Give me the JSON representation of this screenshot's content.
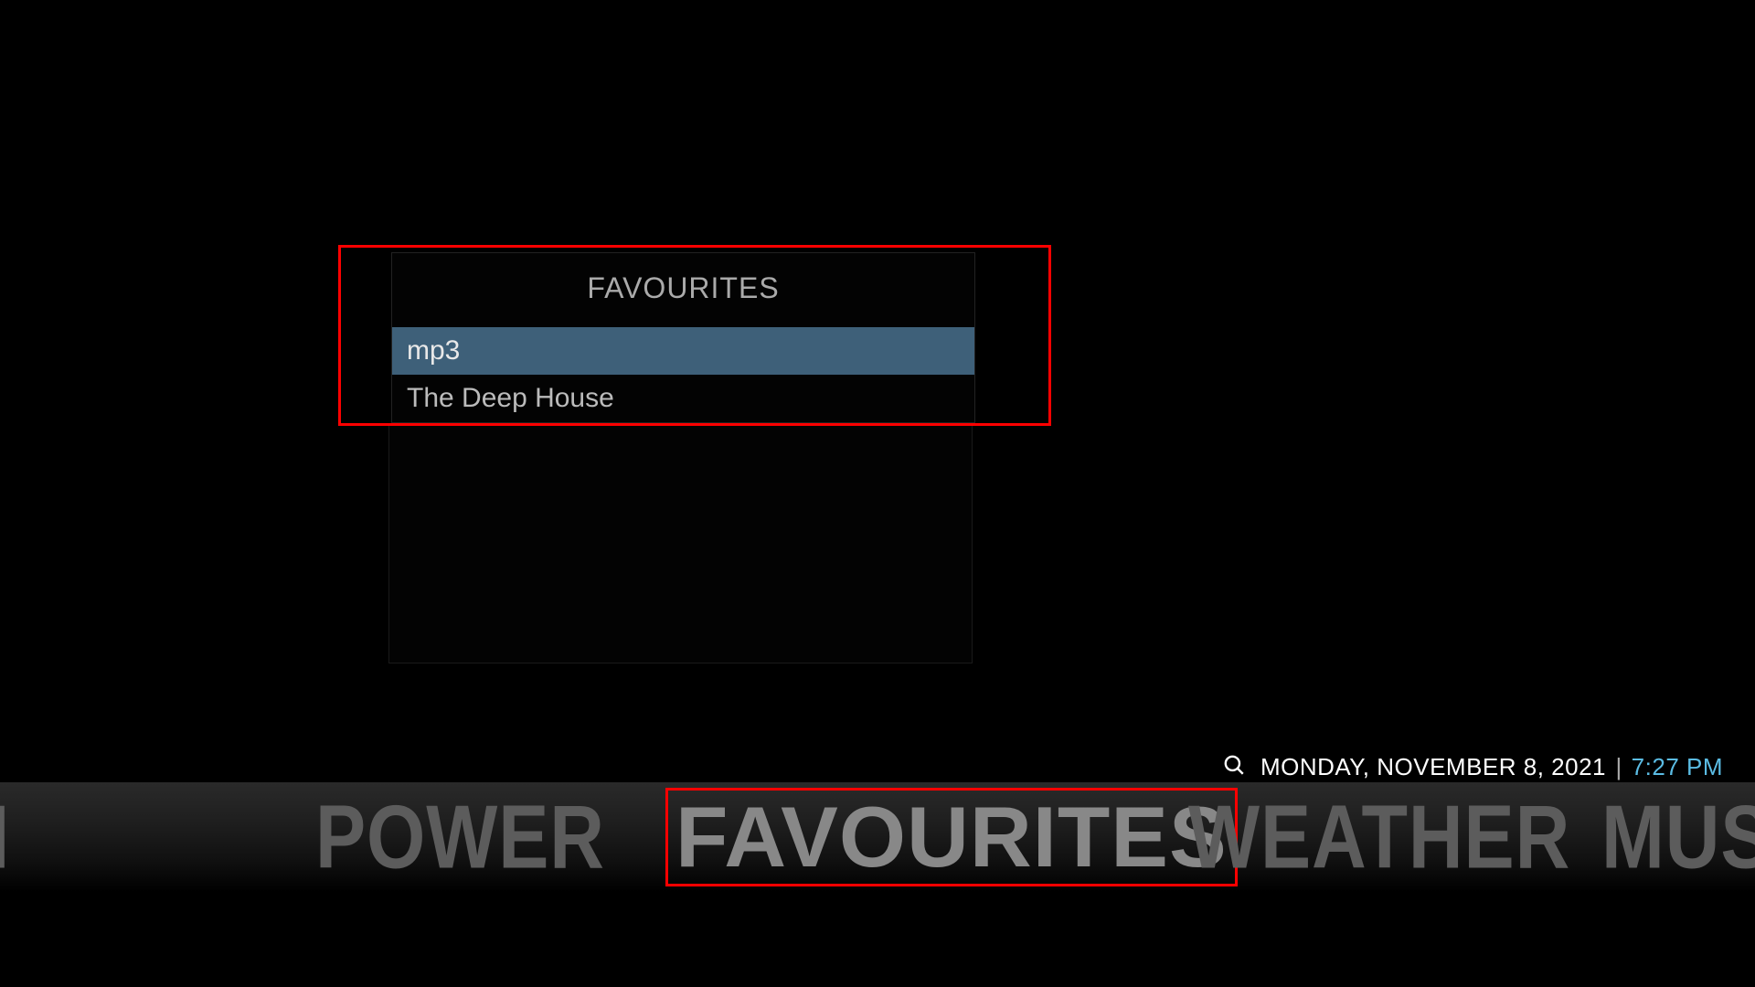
{
  "panel": {
    "title": "FAVOURITES",
    "items": [
      {
        "label": "mp3",
        "selected": true
      },
      {
        "label": "The Deep House",
        "selected": false
      }
    ]
  },
  "status": {
    "date": "MONDAY, NOVEMBER 8, 2021",
    "separator": "|",
    "time": "7:27 PM"
  },
  "menu": {
    "items": [
      {
        "label": "CH"
      },
      {
        "label": "POWER"
      },
      {
        "label": "FAVOURITES"
      },
      {
        "label": "WEATHER"
      },
      {
        "label": "MUSIC"
      }
    ],
    "active_index": 2
  },
  "colors": {
    "highlight_bg": "#3e6079",
    "accent_time": "#5bbce4",
    "annotation_red": "#ff0000"
  }
}
